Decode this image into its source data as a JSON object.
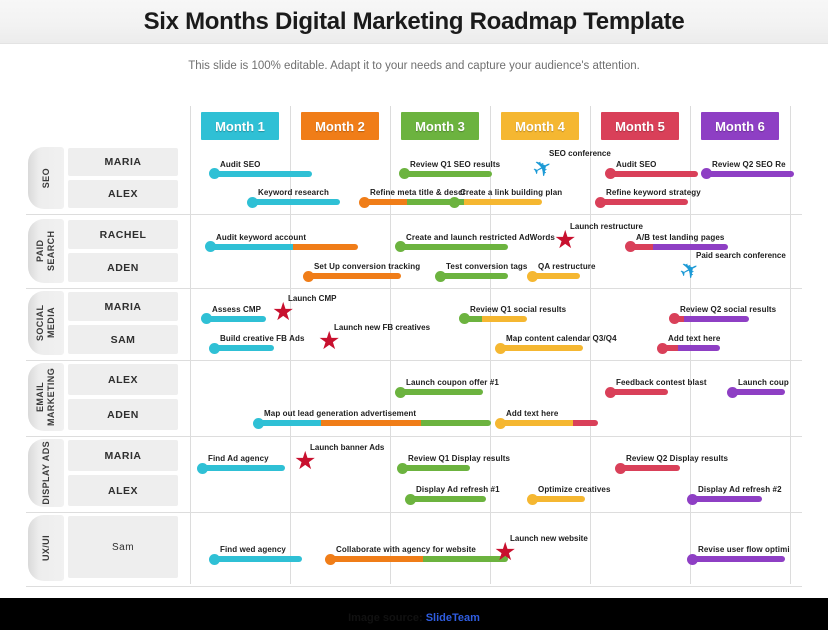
{
  "header": {
    "title": "Six Months Digital Marketing Roadmap Template",
    "subtitle": "This slide is 100% editable. Adapt it to your needs and capture your audience's attention."
  },
  "footer": {
    "prefix": "Image source: ",
    "brand": "SlideTeam"
  },
  "colors": {
    "month1": "#2fc0d5",
    "month2": "#f07d18",
    "month3": "#6cb33f",
    "month4": "#f5b731",
    "month5": "#d94059",
    "month6": "#8e3fc4",
    "milestone": "#c8102e",
    "plane": "#1c9ad6",
    "brand": "#2f5de0"
  },
  "months": [
    {
      "label": "Month 1",
      "color": "#2fc0d5"
    },
    {
      "label": "Month 2",
      "color": "#f07d18"
    },
    {
      "label": "Month 3",
      "color": "#6cb33f"
    },
    {
      "label": "Month 4",
      "color": "#f5b731"
    },
    {
      "label": "Month 5",
      "color": "#d94059"
    },
    {
      "label": "Month 6",
      "color": "#8e3fc4"
    }
  ],
  "rows": [
    {
      "category": "SEO",
      "people": [
        "MARIA",
        "ALEX"
      ]
    },
    {
      "category": "PAID SEARCH",
      "people": [
        "RACHEL",
        "ADEN"
      ]
    },
    {
      "category": "SOCIAL MEDIA",
      "people": [
        "MARIA",
        "SAM"
      ]
    },
    {
      "category": "EMAIL MARKETING",
      "people": [
        "ALEX",
        "ADEN"
      ]
    },
    {
      "category": "DISPLAY ADS",
      "people": [
        "MARIA",
        "ALEX"
      ]
    },
    {
      "category": "UX/UI",
      "people": [
        "Sam"
      ]
    }
  ],
  "chart_data": {
    "type": "gantt",
    "title": "Six Months Digital Marketing Roadmap Template",
    "categories": [
      "SEO",
      "PAID SEARCH",
      "SOCIAL MEDIA",
      "EMAIL MARKETING",
      "DISPLAY ADS",
      "UX/UI"
    ],
    "timeline": [
      "Month 1",
      "Month 2",
      "Month 3",
      "Month 4",
      "Month 5",
      "Month 6"
    ],
    "tasks": [
      {
        "label": "Audit SEO",
        "row": "SEO",
        "lane": 0,
        "segments": [
          {
            "color": "#2fc0d5",
            "span": 1.0
          }
        ]
      },
      {
        "label": "Keyword research",
        "row": "SEO",
        "lane": 1,
        "segments": [
          {
            "color": "#2fc0d5",
            "span": 0.9
          }
        ]
      },
      {
        "label": "Review Q1 SEO results",
        "row": "SEO",
        "lane": 0,
        "segments": [
          {
            "color": "#6cb33f",
            "span": 0.9
          }
        ]
      },
      {
        "label": "Refine meta title & descr",
        "row": "SEO",
        "lane": 1,
        "segments": [
          {
            "color": "#f07d18",
            "span": 0.45
          },
          {
            "color": "#6cb33f",
            "span": 0.55
          }
        ]
      },
      {
        "label": "Create a link building plan",
        "row": "SEO",
        "lane": 1,
        "segments": [
          {
            "color": "#6cb33f",
            "span": 0.12
          },
          {
            "color": "#f5b731",
            "span": 0.78
          }
        ]
      },
      {
        "label": "Audit SEO",
        "row": "SEO",
        "lane": 0,
        "segments": [
          {
            "color": "#d94059",
            "span": 0.9
          }
        ]
      },
      {
        "label": "Refine keyword strategy",
        "row": "SEO",
        "lane": 1,
        "segments": [
          {
            "color": "#d94059",
            "span": 0.9
          }
        ]
      },
      {
        "label": "Review Q2 SEO Re",
        "row": "SEO",
        "lane": 0,
        "segments": [
          {
            "color": "#8e3fc4",
            "span": 0.9
          }
        ]
      },
      {
        "label": "SEO conference",
        "row": "SEO",
        "lane": 0,
        "milestone": "plane"
      },
      {
        "label": "Audit keyword account",
        "row": "PAID SEARCH",
        "lane": 0,
        "segments": [
          {
            "color": "#2fc0d5",
            "span": 0.85
          },
          {
            "color": "#f07d18",
            "span": 0.65
          }
        ]
      },
      {
        "label": "Set Up conversion tracking",
        "row": "PAID SEARCH",
        "lane": 1,
        "segments": [
          {
            "color": "#f07d18",
            "span": 0.95
          }
        ]
      },
      {
        "label": "Create and launch restricted AdWords",
        "row": "PAID SEARCH",
        "lane": 0,
        "segments": [
          {
            "color": "#6cb33f",
            "span": 1.1
          }
        ]
      },
      {
        "label": "Test conversion tags",
        "row": "PAID SEARCH",
        "lane": 1,
        "segments": [
          {
            "color": "#6cb33f",
            "span": 0.7
          }
        ]
      },
      {
        "label": "QA restructure",
        "row": "PAID SEARCH",
        "lane": 1,
        "segments": [
          {
            "color": "#f5b731",
            "span": 0.5
          }
        ]
      },
      {
        "label": "Launch restructure",
        "row": "PAID SEARCH",
        "lane": 0,
        "milestone": "star"
      },
      {
        "label": "A/B test landing pages",
        "row": "PAID SEARCH",
        "lane": 0,
        "segments": [
          {
            "color": "#d94059",
            "span": 0.25
          },
          {
            "color": "#8e3fc4",
            "span": 0.75
          }
        ]
      },
      {
        "label": "Paid search conference",
        "row": "PAID SEARCH",
        "lane": 1,
        "milestone": "plane"
      },
      {
        "label": "Assess CMP",
        "row": "SOCIAL MEDIA",
        "lane": 0,
        "segments": [
          {
            "color": "#2fc0d5",
            "span": 0.62
          }
        ]
      },
      {
        "label": "Launch CMP",
        "row": "SOCIAL MEDIA",
        "lane": 0,
        "milestone": "star"
      },
      {
        "label": "Build creative FB Ads",
        "row": "SOCIAL MEDIA",
        "lane": 1,
        "segments": [
          {
            "color": "#2fc0d5",
            "span": 0.62
          }
        ]
      },
      {
        "label": "Launch new FB creatives",
        "row": "SOCIAL MEDIA",
        "lane": 1,
        "milestone": "star"
      },
      {
        "label": "Review Q1 social results",
        "row": "SOCIAL MEDIA",
        "lane": 0,
        "segments": [
          {
            "color": "#6cb33f",
            "span": 0.2
          },
          {
            "color": "#f5b731",
            "span": 0.45
          }
        ]
      },
      {
        "label": "Map content calendar Q3/Q4",
        "row": "SOCIAL MEDIA",
        "lane": 1,
        "segments": [
          {
            "color": "#f5b731",
            "span": 0.85
          }
        ]
      },
      {
        "label": "Review Q2 social results",
        "row": "SOCIAL MEDIA",
        "lane": 0,
        "segments": [
          {
            "color": "#d94059",
            "span": 0.12
          },
          {
            "color": "#8e3fc4",
            "span": 0.65
          }
        ]
      },
      {
        "label": "Add text here",
        "row": "SOCIAL MEDIA",
        "lane": 1,
        "segments": [
          {
            "color": "#d94059",
            "span": 0.18
          },
          {
            "color": "#8e3fc4",
            "span": 0.42
          }
        ]
      },
      {
        "label": "Launch coupon offer #1",
        "row": "EMAIL MARKETING",
        "lane": 0,
        "segments": [
          {
            "color": "#6cb33f",
            "span": 0.85
          }
        ]
      },
      {
        "label": "Map out lead generation advertisement",
        "row": "EMAIL MARKETING",
        "lane": 1,
        "segments": [
          {
            "color": "#2fc0d5",
            "span": 0.65
          },
          {
            "color": "#f07d18",
            "span": 1.0
          },
          {
            "color": "#6cb33f",
            "span": 0.7
          }
        ]
      },
      {
        "label": "Add text here",
        "row": "EMAIL MARKETING",
        "lane": 1,
        "segments": [
          {
            "color": "#f5b731",
            "span": 0.75
          },
          {
            "color": "#d94059",
            "span": 0.25
          }
        ]
      },
      {
        "label": "Feedback contest blast",
        "row": "EMAIL MARKETING",
        "lane": 0,
        "segments": [
          {
            "color": "#d94059",
            "span": 0.6
          }
        ]
      },
      {
        "label": "Launch coup",
        "row": "EMAIL MARKETING",
        "lane": 0,
        "segments": [
          {
            "color": "#8e3fc4",
            "span": 0.55
          }
        ]
      },
      {
        "label": "Find Ad agency",
        "row": "DISPLAY ADS",
        "lane": 0,
        "segments": [
          {
            "color": "#2fc0d5",
            "span": 0.85
          }
        ]
      },
      {
        "label": "Launch banner Ads",
        "row": "DISPLAY ADS",
        "lane": 0,
        "milestone": "star"
      },
      {
        "label": "Review Q1 Display results",
        "row": "DISPLAY ADS",
        "lane": 0,
        "segments": [
          {
            "color": "#6cb33f",
            "span": 0.7
          }
        ]
      },
      {
        "label": "Display Ad refresh #1",
        "row": "DISPLAY ADS",
        "lane": 1,
        "segments": [
          {
            "color": "#6cb33f",
            "span": 0.78
          }
        ]
      },
      {
        "label": "Optimize creatives",
        "row": "DISPLAY ADS",
        "lane": 1,
        "segments": [
          {
            "color": "#f5b731",
            "span": 0.55
          }
        ]
      },
      {
        "label": "Review Q2 Display results",
        "row": "DISPLAY ADS",
        "lane": 0,
        "segments": [
          {
            "color": "#d94059",
            "span": 0.62
          }
        ]
      },
      {
        "label": "Display Ad refresh #2",
        "row": "DISPLAY ADS",
        "lane": 1,
        "segments": [
          {
            "color": "#8e3fc4",
            "span": 0.72
          }
        ]
      },
      {
        "label": "Find wed agency",
        "row": "UX/UI",
        "lane": 0,
        "segments": [
          {
            "color": "#2fc0d5",
            "span": 0.9
          }
        ]
      },
      {
        "label": "Collaborate with agency for website",
        "row": "UX/UI",
        "lane": 0,
        "segments": [
          {
            "color": "#f07d18",
            "span": 0.95
          },
          {
            "color": "#6cb33f",
            "span": 0.85
          }
        ]
      },
      {
        "label": "Launch new website",
        "row": "UX/UI",
        "lane": 0,
        "milestone": "star"
      },
      {
        "label": "Revise user flow optimi",
        "row": "UX/UI",
        "lane": 0,
        "segments": [
          {
            "color": "#8e3fc4",
            "span": 0.95
          }
        ]
      }
    ]
  }
}
